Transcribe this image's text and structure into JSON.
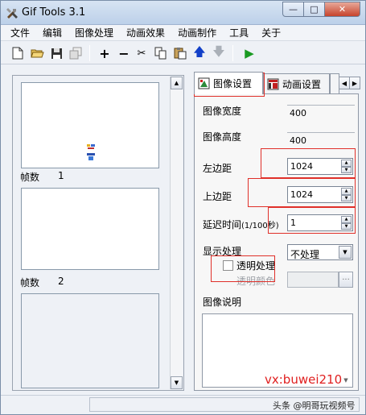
{
  "window": {
    "title": "Gif Tools 3.1",
    "controls": {
      "minimize": "—",
      "maximize": "□",
      "close": "✕"
    }
  },
  "menu": [
    "文件",
    "编辑",
    "图像处理",
    "动画效果",
    "动画制作",
    "工具",
    "关于"
  ],
  "toolbar": {
    "icons": [
      "new-file-icon",
      "open-folder-icon",
      "save-icon",
      "copy-frames-icon",
      "add-icon",
      "remove-icon",
      "cut-icon",
      "copy-icon",
      "paste-icon",
      "move-up-icon",
      "move-down-icon",
      "play-icon"
    ],
    "glyphs": {
      "add": "+",
      "remove": "−",
      "cut": "✂",
      "up": "🡅",
      "down": "🡇",
      "play": "▶"
    }
  },
  "frames": [
    {
      "caption": "帧数",
      "number": "1"
    },
    {
      "caption": "帧数",
      "number": "2"
    }
  ],
  "tabs": [
    {
      "label": "图像设置",
      "active": true
    },
    {
      "label": "动画设置",
      "active": false
    },
    {
      "label": "",
      "active": false
    }
  ],
  "image_settings": {
    "width_label": "图像宽度",
    "width_value": "400",
    "height_label": "图像高度",
    "height_value": "400",
    "left_margin_label": "左边距",
    "left_margin_value": "1024",
    "top_margin_label": "上边距",
    "top_margin_value": "1024",
    "delay_label": "延迟时间",
    "delay_unit": "(1/100秒)",
    "delay_value": "1",
    "display_label": "显示处理",
    "display_value": "不处理",
    "transparent_label": "透明处理",
    "transparent_checked": false,
    "transparent_color_label": "透明颜色",
    "color_button": "···",
    "description_label": "图像说明"
  },
  "overlay": {
    "vx": "vx:buwei210",
    "watermark": "头条 @明哥玩视频号"
  },
  "colors": {
    "accent_red": "#e0302a",
    "tab_active": "#ffffff"
  }
}
